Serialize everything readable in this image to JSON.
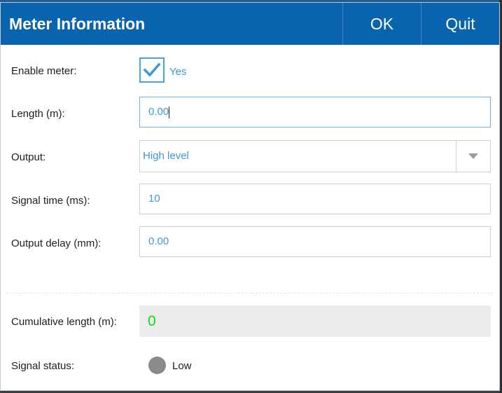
{
  "dialog": {
    "title": "Meter Information",
    "ok_label": "OK",
    "quit_label": "Quit"
  },
  "fields": {
    "enable_meter": {
      "label": "Enable meter:",
      "checked": true,
      "option_label": "Yes"
    },
    "length": {
      "label": "Length (m):",
      "value": "0.00"
    },
    "output": {
      "label": "Output:",
      "value": "High level"
    },
    "signal_time": {
      "label": "Signal time (ms):",
      "value": "10"
    },
    "output_delay": {
      "label": "Output delay (mm):",
      "value": "0.00"
    },
    "cumulative_length": {
      "label": "Cumulative length (m):",
      "value": "0"
    },
    "signal_status": {
      "label": "Signal status:",
      "value": "Low"
    }
  },
  "colors": {
    "titlebar": "#0a64ad",
    "accent": "#3d9ad9",
    "cumulative_value": "#18d418",
    "status_dot": "#8a8a8a"
  }
}
